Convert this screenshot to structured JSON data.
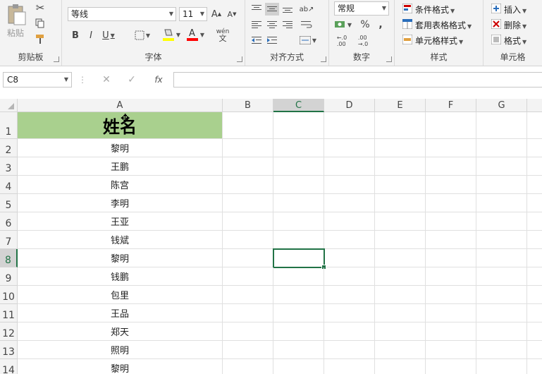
{
  "ribbon": {
    "clipboard": {
      "label": "剪贴板",
      "paste": "粘贴"
    },
    "font": {
      "label": "字体",
      "font_name": "等线",
      "font_size": "11",
      "phonetic": "wén"
    },
    "alignment": {
      "label": "对齐方式"
    },
    "number": {
      "label": "数字",
      "format": "常规",
      "percent": "%",
      "comma": ","
    },
    "styles": {
      "label": "样式",
      "conditional": "条件格式",
      "table": "套用表格格式",
      "cell_styles": "单元格样式"
    },
    "cells": {
      "label": "单元格",
      "insert": "插入",
      "delete": "删除",
      "format": "格式"
    }
  },
  "formula_bar": {
    "name_box": "C8",
    "fx": "fx",
    "value": ""
  },
  "columns": [
    "A",
    "B",
    "C",
    "D",
    "E",
    "F",
    "G"
  ],
  "rows": [
    "1",
    "2",
    "3",
    "4",
    "5",
    "6",
    "7",
    "8",
    "9",
    "10",
    "11",
    "12",
    "13",
    "14"
  ],
  "cells": {
    "header": "姓名",
    "names": [
      "黎明",
      "王鹏",
      "陈宫",
      "李明",
      "王亚",
      "钱斌",
      "黎明",
      "钱鹏",
      "包里",
      "王品",
      "郑天",
      "照明",
      "黎明"
    ]
  },
  "selected_cell": "C8",
  "colors": {
    "header_fill": "#a9d08e",
    "accent": "#217346"
  }
}
